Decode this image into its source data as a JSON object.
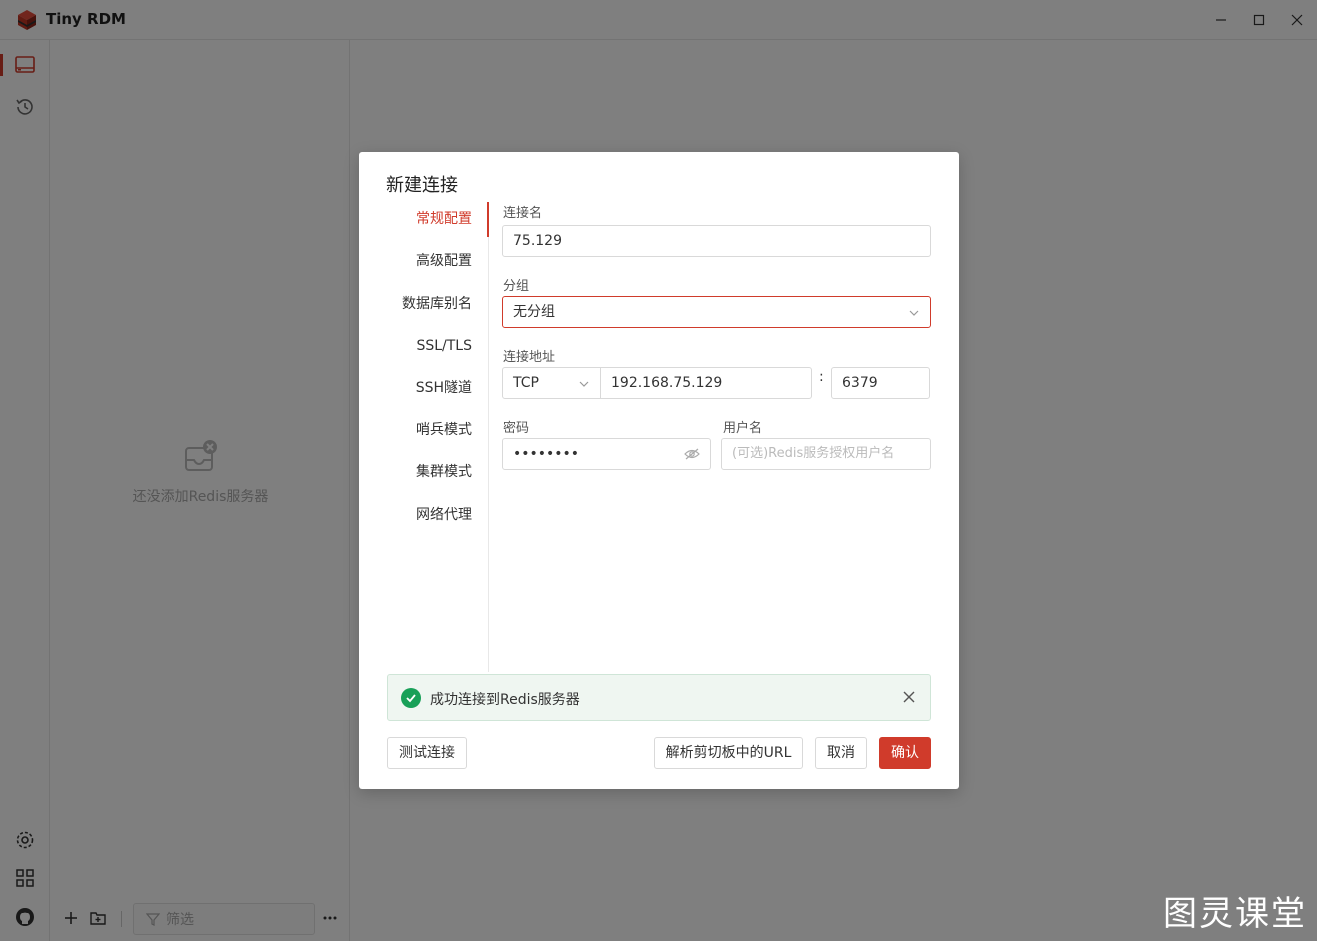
{
  "window": {
    "title": "Tiny RDM",
    "minimize_icon": "minimize-icon",
    "maximize_icon": "maximize-icon",
    "close_icon": "close-icon"
  },
  "leftbar": {
    "items": [
      {
        "icon": "server-icon",
        "active": true
      },
      {
        "icon": "history-icon",
        "active": false
      }
    ],
    "bottom": [
      {
        "icon": "settings-icon"
      },
      {
        "icon": "apps-icon"
      },
      {
        "icon": "github-icon"
      }
    ]
  },
  "sidepanel": {
    "empty_text": "还没添加Redis服务器",
    "filter_placeholder": "筛选"
  },
  "dialog": {
    "title": "新建连接",
    "tabs": [
      {
        "label": "常规配置",
        "active": true
      },
      {
        "label": "高级配置",
        "active": false
      },
      {
        "label": "数据库别名",
        "active": false
      },
      {
        "label": "SSL/TLS",
        "active": false
      },
      {
        "label": "SSH隧道",
        "active": false
      },
      {
        "label": "哨兵模式",
        "active": false
      },
      {
        "label": "集群模式",
        "active": false
      },
      {
        "label": "网络代理",
        "active": false
      }
    ],
    "form": {
      "name_label": "连接名",
      "name_value": "75.129",
      "group_label": "分组",
      "group_value": "无分组",
      "address_label": "连接地址",
      "protocol_value": "TCP",
      "host_value": "192.168.75.129",
      "port_separator": ":",
      "port_value": "6379",
      "password_label": "密码",
      "password_value": "••••••••",
      "username_label": "用户名",
      "username_placeholder": "(可选)Redis服务授权用户名"
    },
    "alert": {
      "message": "成功连接到Redis服务器",
      "type": "success"
    },
    "buttons": {
      "test": "测试连接",
      "parse_url": "解析剪切板中的URL",
      "cancel": "取消",
      "confirm": "确认"
    }
  },
  "watermark": "图灵课堂",
  "colors": {
    "accent": "#d03b2b",
    "success": "#18a058"
  }
}
